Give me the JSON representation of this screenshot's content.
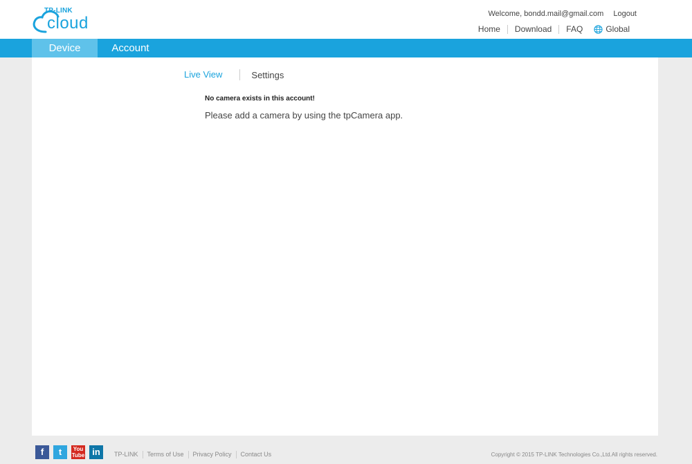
{
  "header": {
    "logo_top": "TP-LINK",
    "logo_bottom": "cloud",
    "welcome": "Welcome, bondd.mail@gmail.com",
    "logout": "Logout",
    "nav": [
      "Home",
      "Download",
      "FAQ"
    ],
    "region": "Global"
  },
  "navbar": {
    "tabs": [
      {
        "label": "Device",
        "active": true
      },
      {
        "label": "Account",
        "active": false
      }
    ]
  },
  "main": {
    "subtabs": [
      {
        "label": "Live View",
        "active": true
      },
      {
        "label": "Settings",
        "active": false
      }
    ],
    "message_title": "No camera exists in this account!",
    "message_body": "Please add a camera by using the tpCamera app."
  },
  "footer": {
    "social": [
      {
        "icon": "facebook-icon",
        "glyph": "f"
      },
      {
        "icon": "twitter-icon",
        "glyph": "t"
      },
      {
        "icon": "youtube-icon",
        "glyph": "You Tube"
      },
      {
        "icon": "linkedin-icon",
        "glyph": "in"
      }
    ],
    "links": [
      "TP-LINK",
      "Terms of Use",
      "Privacy Policy",
      "Contact Us"
    ],
    "copyright": "Copyright © 2015 TP-LINK Technologies Co.,Ltd.All rights reserved."
  },
  "colors": {
    "brand": "#1aa3dd",
    "active_tab": "#5fc2ea",
    "page_bg": "#ececec"
  }
}
